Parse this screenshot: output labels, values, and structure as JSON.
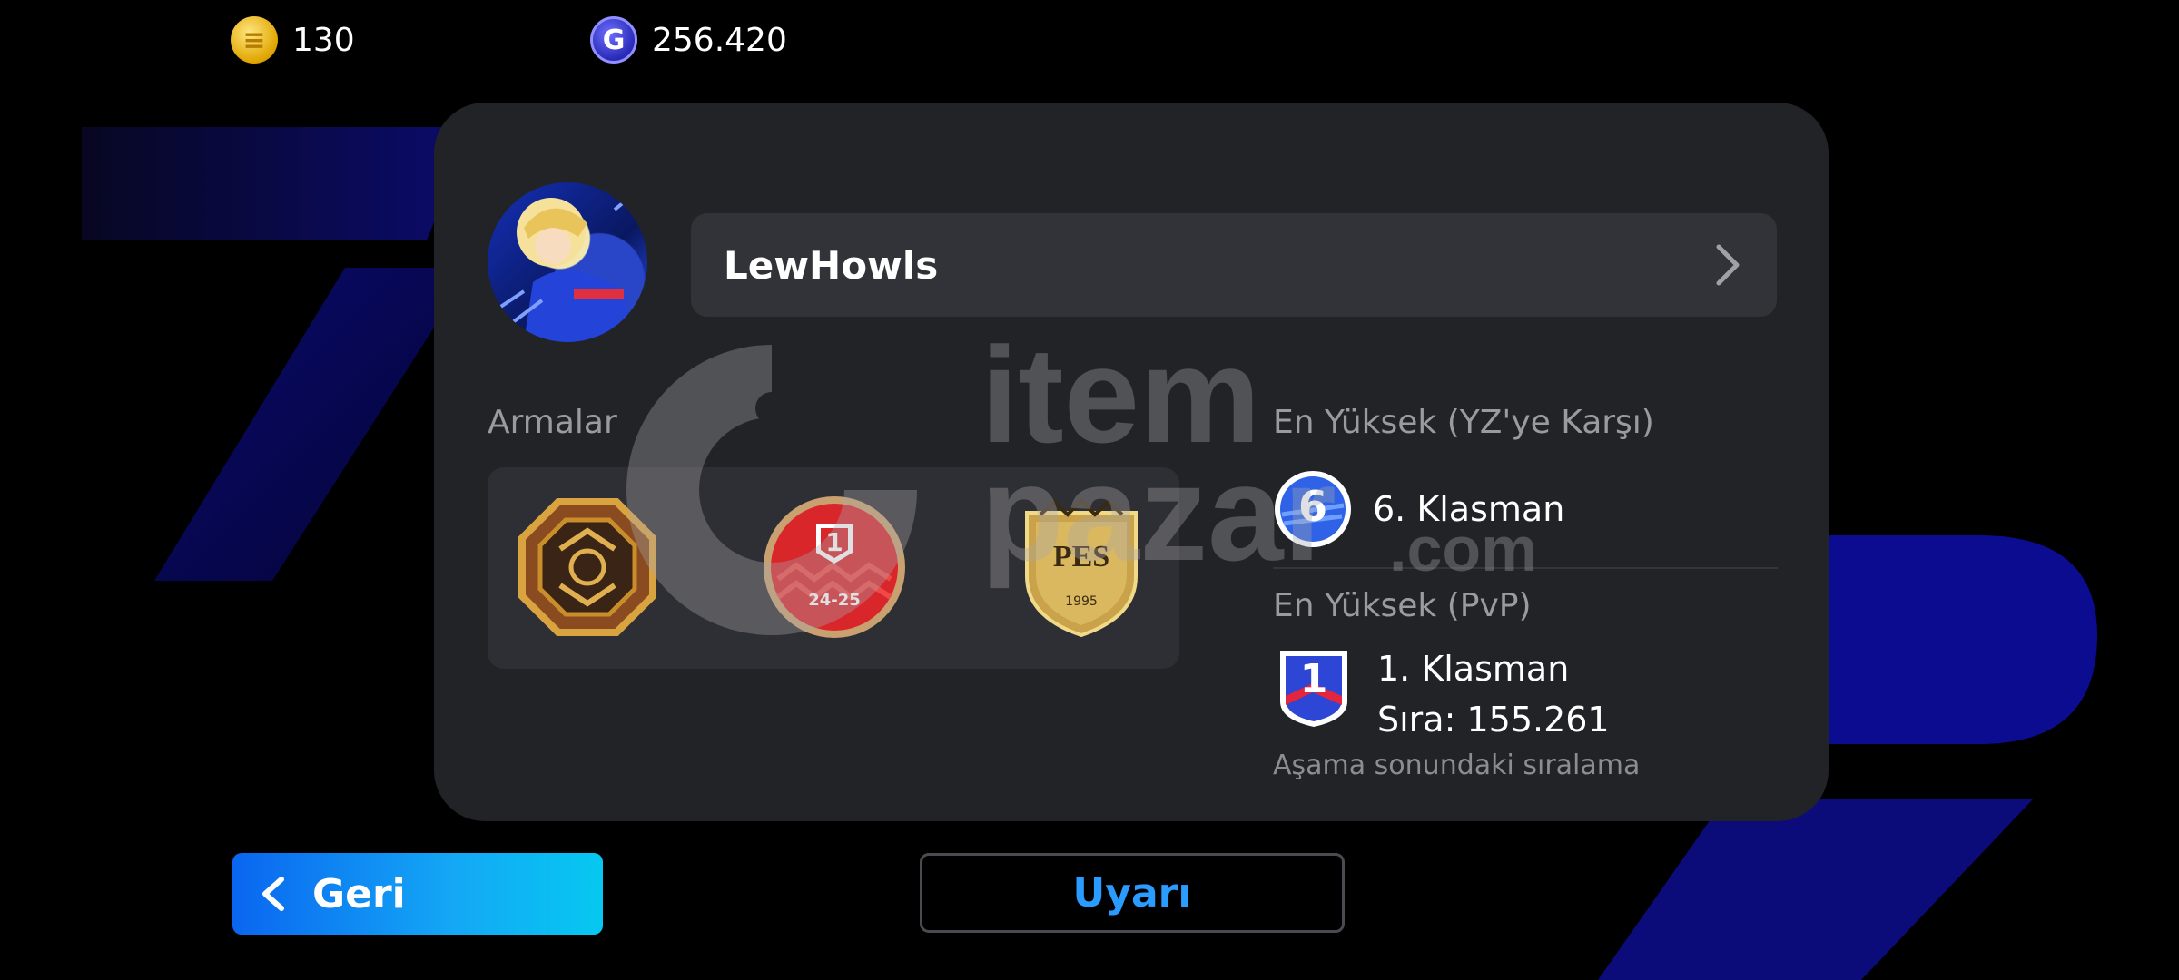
{
  "currency": {
    "coins": {
      "icon": "coin-icon",
      "value": "130",
      "color": "#f2b400"
    },
    "gp": {
      "icon": "gp-icon",
      "glyph": "G",
      "value": "256.420",
      "color": "#3a3ad8"
    }
  },
  "profile": {
    "username": "LewHowls",
    "avatar_icon": "avatar-image"
  },
  "emblems": {
    "heading": "Armalar",
    "items": [
      {
        "icon": "octagon-emblem-icon"
      },
      {
        "icon": "division-emblem-icon",
        "number": "1",
        "season": "24-25"
      },
      {
        "icon": "pes-shield-emblem-icon",
        "text": "PES",
        "year": "1995"
      }
    ]
  },
  "ranks": {
    "ai": {
      "heading": "En Yüksek (YZ'ye Karşı)",
      "badge": "6",
      "label": "6. Klasman"
    },
    "pvp": {
      "heading": "En Yüksek (PvP)",
      "badge": "1",
      "label": "1. Klasman",
      "rank": "Sıra: 155.261"
    },
    "note": "Aşama sonundaki sıralama"
  },
  "buttons": {
    "back": "Geri",
    "report": "Uyarı"
  },
  "watermark": {
    "line1": "item",
    "line2": "pazar",
    "suffix": ".com"
  },
  "colors": {
    "accent": "#14a8f5",
    "report_text": "#2a9cff",
    "card_bg": "#222327"
  }
}
